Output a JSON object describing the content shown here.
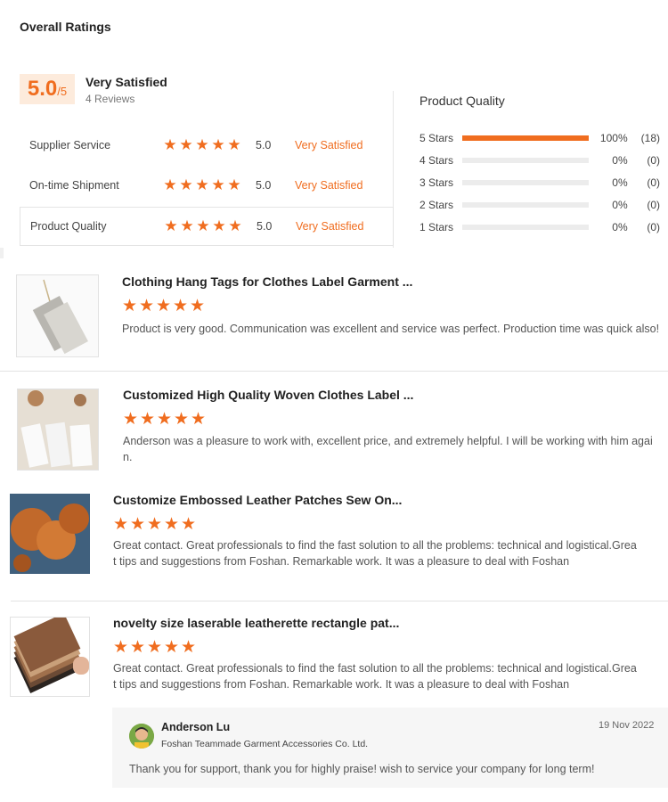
{
  "overall": {
    "title": "Overall Ratings",
    "score": "5.0",
    "score_suffix": "/5",
    "satisfaction": "Very Satisfied",
    "reviews_count": "4 Reviews"
  },
  "categories": [
    {
      "label": "Supplier Service",
      "score": "5.0",
      "desc": "Very Satisfied",
      "stars": 5
    },
    {
      "label": "On-time Shipment",
      "score": "5.0",
      "desc": "Very Satisfied",
      "stars": 5
    },
    {
      "label": "Product Quality",
      "score": "5.0",
      "desc": "Very Satisfied",
      "stars": 5
    }
  ],
  "product_quality": {
    "title": "Product Quality",
    "rows": [
      {
        "label": "5 Stars",
        "pct": "100%",
        "count": "(18)",
        "fill": 1.0
      },
      {
        "label": "4 Stars",
        "pct": "0%",
        "count": "(0)",
        "fill": 0
      },
      {
        "label": "3 Stars",
        "pct": "0%",
        "count": "(0)",
        "fill": 0
      },
      {
        "label": "2 Stars",
        "pct": "0%",
        "count": "(0)",
        "fill": 0
      },
      {
        "label": "1 Stars",
        "pct": "0%",
        "count": "(0)",
        "fill": 0
      }
    ]
  },
  "reviews": [
    {
      "title": "Clothing Hang Tags for Clothes Label Garment ...",
      "stars": 5,
      "text": "Product is very good. Communication was excellent and service was perfect. Production time was quick also!",
      "image": "hang-tag-image"
    },
    {
      "title": "Customized High Quality Woven Clothes Label ...",
      "stars": 5,
      "text": "Anderson was a pleasure to work with, excellent price, and extremely helpful. I will be working with him again.",
      "image": "woven-label-image"
    },
    {
      "title": "Customize Embossed Leather Patches Sew On...",
      "stars": 5,
      "text": "Great contact. Great professionals to find the fast solution to all the problems: technical and logistical.Great tips and suggestions from Foshan. Remarkable work. It was a pleasure to deal with Foshan",
      "image": "leather-patch-image"
    },
    {
      "title": "novelty size laserable leatherette rectangle pat...",
      "stars": 5,
      "text": "Great contact. Great professionals to find the fast solution to all the problems: technical and logistical.Great tips and suggestions from Foshan. Remarkable work. It was a pleasure to deal with Foshan",
      "image": "leatherette-samples-image"
    }
  ],
  "reply": {
    "name": "Anderson Lu",
    "company": "Foshan Teammade Garment Accessories Co. Ltd.",
    "date": "19 Nov 2022",
    "text": "Thank you for  support, thank you for  highly praise!  wish to service your company for long term!"
  },
  "colors": {
    "accent": "#f06d1f",
    "accent_bg": "#fdebdc",
    "track": "#ececec"
  }
}
